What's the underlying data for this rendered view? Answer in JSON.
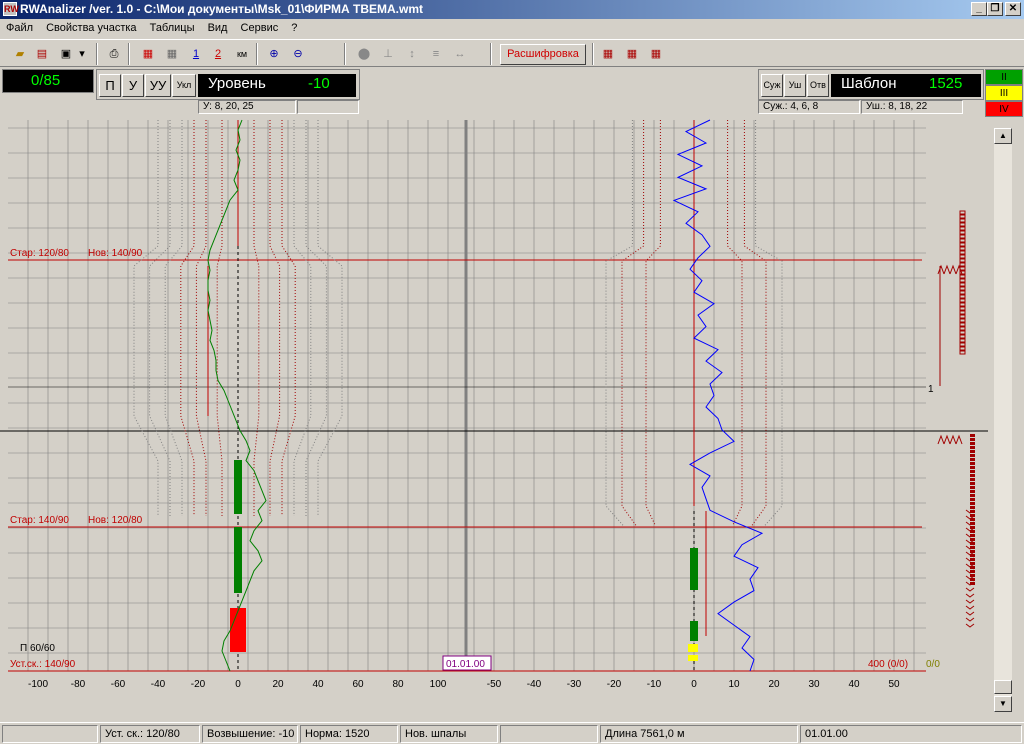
{
  "window": {
    "title": "RWAnalizer /ver. 1.0 - C:\\Мои документы\\Msk_01\\ФИРМА    TBEMA.wmt",
    "minimize": "_",
    "maximize": "❐",
    "close": "✕"
  },
  "menu": [
    "Файл",
    "Свойства участка",
    "Таблицы",
    "Вид",
    "Сервис",
    "?"
  ],
  "toolbar": {
    "decode_label": "Расшифровка",
    "thread1": "1",
    "thread2": "2",
    "km": "км"
  },
  "counter": "0/85",
  "level_panel": {
    "buttons": [
      "П",
      "У",
      "УУ",
      "Укл"
    ],
    "title": "Уровень",
    "value": "-10",
    "thresholds": "У: 8, 20, 25"
  },
  "gauge_panel": {
    "buttons": [
      "Суж",
      "Уш",
      "Отв"
    ],
    "title": "Шаблон",
    "value": "1525",
    "narrow": "Суж.: 4, 6, 8",
    "wide": "Уш.: 8, 18, 22"
  },
  "levels": [
    {
      "label": "II",
      "color": "#00a000"
    },
    {
      "label": "III",
      "color": "#ffff00"
    },
    {
      "label": "IV",
      "color": "#ff0000"
    }
  ],
  "annotations": {
    "speed1_old": "Стар: 120/80",
    "speed1_new": "Нов: 140/90",
    "speed2_old": "Стар: 140/90",
    "speed2_new": "Нов: 120/80",
    "p_label": "П 60/60",
    "set_speed": "Уст.ск.: 140/90",
    "date": "01.01.00",
    "right_count": "400 (0/0)",
    "right_ratio": "0/0",
    "marker": "1"
  },
  "chart_data": {
    "type": "line",
    "left_axis": {
      "ticks": [
        -100,
        -80,
        -60,
        -40,
        -20,
        0,
        20,
        40,
        60,
        80,
        100
      ],
      "series": "level",
      "color": "#008000"
    },
    "right_axis": {
      "ticks": [
        -50,
        -40,
        -30,
        -20,
        -10,
        0,
        10,
        20,
        30,
        40,
        50
      ],
      "series": "gauge",
      "color": "#0000ff"
    },
    "level_values": [
      2,
      0,
      1,
      -1,
      1,
      0,
      -2,
      0,
      -4,
      -6,
      -8,
      -10,
      -12,
      -14,
      -15,
      -14,
      -15,
      -15,
      -14,
      -15,
      -14,
      -13,
      -14,
      -12,
      -11,
      -11,
      -10,
      -7,
      -5,
      -3,
      -1,
      1,
      4,
      6,
      4,
      8,
      10,
      12,
      14,
      10,
      12,
      8,
      6,
      10,
      12,
      8,
      6,
      4,
      2,
      0,
      -2,
      -4,
      -7,
      -8,
      -6,
      -4
    ],
    "gauge_values": [
      4,
      -2,
      3,
      -4,
      2,
      -4,
      3,
      -5,
      1,
      -2,
      2,
      4,
      1,
      -1,
      2,
      0,
      5,
      1,
      3,
      0,
      6,
      3,
      7,
      4,
      5,
      3,
      6,
      7,
      10,
      4,
      -1,
      4,
      2,
      3,
      4,
      10,
      17,
      12,
      10,
      16,
      14,
      15,
      10,
      6,
      10,
      14,
      12,
      15,
      14
    ]
  },
  "status": {
    "set_speed": "Уст. ск.: 120/80",
    "elevation": "Возвышение: -10",
    "norm": "Норма: 1520",
    "sleepers": "Нов. шпалы",
    "length": "Длина 7561,0 м",
    "date": "01.01.00"
  }
}
